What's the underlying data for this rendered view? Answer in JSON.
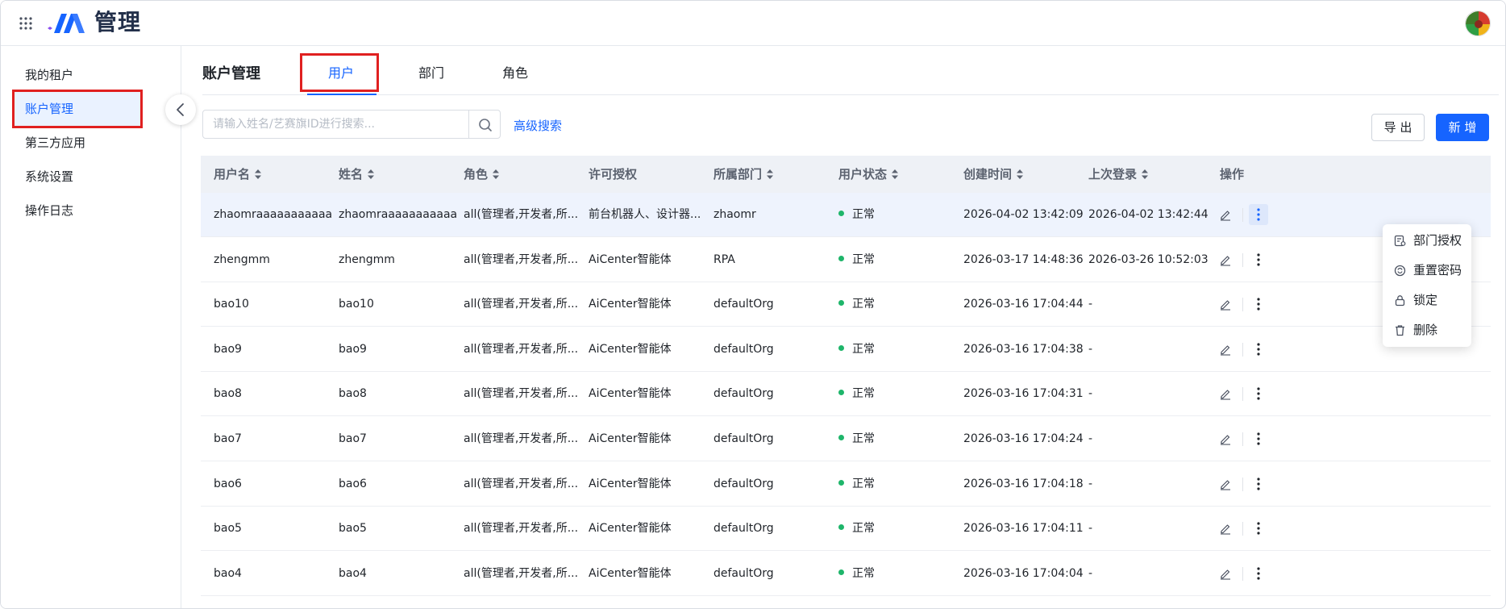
{
  "header": {
    "title": "管理",
    "apps_icon": "grid-icon",
    "logo_icon": "brand-logo-icon",
    "avatar_icon": "user-avatar"
  },
  "sidebar": {
    "items": [
      {
        "label": "我的租户",
        "active": false
      },
      {
        "label": "账户管理",
        "active": true
      },
      {
        "label": "第三方应用",
        "active": false
      },
      {
        "label": "系统设置",
        "active": false
      },
      {
        "label": "操作日志",
        "active": false
      }
    ],
    "collapse_icon": "chevron-left-icon"
  },
  "page": {
    "title": "账户管理",
    "tabs": [
      {
        "label": "用户",
        "active": true
      },
      {
        "label": "部门",
        "active": false
      },
      {
        "label": "角色",
        "active": false
      }
    ]
  },
  "toolbar": {
    "search_placeholder": "请输入姓名/艺赛旗ID进行搜索...",
    "search_value": "",
    "advanced_search": "高级搜索",
    "export_label": "导 出",
    "add_label": "新 增"
  },
  "table": {
    "columns": [
      {
        "label": "用户名",
        "sortable": true
      },
      {
        "label": "姓名",
        "sortable": true
      },
      {
        "label": "角色",
        "sortable": true
      },
      {
        "label": "许可授权",
        "sortable": false
      },
      {
        "label": "所属部门",
        "sortable": true
      },
      {
        "label": "用户状态",
        "sortable": true
      },
      {
        "label": "创建时间",
        "sortable": true
      },
      {
        "label": "上次登录",
        "sortable": true
      },
      {
        "label": "操作",
        "sortable": false
      }
    ],
    "rows": [
      {
        "username": "zhaomraaaaaaaaaaaaa...",
        "name": "zhaomraaaaaaaaaaaaa...",
        "role": "all(管理者,开发者,所...",
        "license": "前台机器人、设计器...",
        "dept": "zhaomr",
        "status": "正常",
        "created": "2026-04-02 13:42:09",
        "last_login": "2026-04-02 13:42:44"
      },
      {
        "username": "zhengmm",
        "name": "zhengmm",
        "role": "all(管理者,开发者,所...",
        "license": "AiCenter智能体",
        "dept": "RPA",
        "status": "正常",
        "created": "2026-03-17 14:48:36",
        "last_login": "2026-03-26 10:52:03"
      },
      {
        "username": "bao10",
        "name": "bao10",
        "role": "all(管理者,开发者,所...",
        "license": "AiCenter智能体",
        "dept": "defaultOrg",
        "status": "正常",
        "created": "2026-03-16 17:04:44",
        "last_login": "-"
      },
      {
        "username": "bao9",
        "name": "bao9",
        "role": "all(管理者,开发者,所...",
        "license": "AiCenter智能体",
        "dept": "defaultOrg",
        "status": "正常",
        "created": "2026-03-16 17:04:38",
        "last_login": "-"
      },
      {
        "username": "bao8",
        "name": "bao8",
        "role": "all(管理者,开发者,所...",
        "license": "AiCenter智能体",
        "dept": "defaultOrg",
        "status": "正常",
        "created": "2026-03-16 17:04:31",
        "last_login": "-"
      },
      {
        "username": "bao7",
        "name": "bao7",
        "role": "all(管理者,开发者,所...",
        "license": "AiCenter智能体",
        "dept": "defaultOrg",
        "status": "正常",
        "created": "2026-03-16 17:04:24",
        "last_login": "-"
      },
      {
        "username": "bao6",
        "name": "bao6",
        "role": "all(管理者,开发者,所...",
        "license": "AiCenter智能体",
        "dept": "defaultOrg",
        "status": "正常",
        "created": "2026-03-16 17:04:18",
        "last_login": "-"
      },
      {
        "username": "bao5",
        "name": "bao5",
        "role": "all(管理者,开发者,所...",
        "license": "AiCenter智能体",
        "dept": "defaultOrg",
        "status": "正常",
        "created": "2026-03-16 17:04:11",
        "last_login": "-"
      },
      {
        "username": "bao4",
        "name": "bao4",
        "role": "all(管理者,开发者,所...",
        "license": "AiCenter智能体",
        "dept": "defaultOrg",
        "status": "正常",
        "created": "2026-03-16 17:04:04",
        "last_login": "-"
      }
    ]
  },
  "dropdown": {
    "items": [
      {
        "label": "部门授权",
        "icon": "dept-auth-icon"
      },
      {
        "label": "重置密码",
        "icon": "reset-password-icon"
      },
      {
        "label": "锁定",
        "icon": "lock-icon"
      },
      {
        "label": "删除",
        "icon": "trash-icon"
      }
    ]
  },
  "colors": {
    "primary": "#1664ff",
    "status_ok": "#1eb56a",
    "highlight_border": "#e02020",
    "header_bg": "#eef1f6"
  }
}
